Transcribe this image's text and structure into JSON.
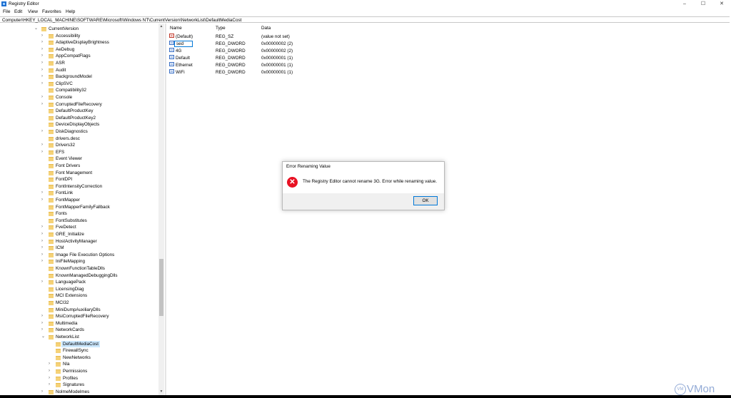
{
  "window": {
    "title": "Registry Editor",
    "controls": {
      "minimize": "–",
      "maximize": "☐",
      "close": "✕"
    }
  },
  "menu": [
    "File",
    "Edit",
    "View",
    "Favorites",
    "Help"
  ],
  "address": "Computer\\HKEY_LOCAL_MACHINE\\SOFTWARE\\Microsoft\\Windows NT\\CurrentVersion\\NetworkList\\DefaultMediaCost",
  "tree": {
    "items": [
      {
        "label": "CurrentVersion",
        "level": 0,
        "expanded": true
      },
      {
        "label": "Accessibility",
        "level": 1,
        "expandable": true
      },
      {
        "label": "AdaptiveDisplayBrightness",
        "level": 1,
        "expandable": true
      },
      {
        "label": "AeDebug",
        "level": 1,
        "expandable": true
      },
      {
        "label": "AppCompatFlags",
        "level": 1,
        "expandable": true
      },
      {
        "label": "ASR",
        "level": 1,
        "expandable": true
      },
      {
        "label": "Audit",
        "level": 1,
        "expandable": true
      },
      {
        "label": "BackgroundModel",
        "level": 1,
        "expandable": true
      },
      {
        "label": "ClipSVC",
        "level": 1,
        "expandable": true
      },
      {
        "label": "Compatibility32",
        "level": 1,
        "expandable": false
      },
      {
        "label": "Console",
        "level": 1,
        "expandable": true
      },
      {
        "label": "CorruptedFileRecovery",
        "level": 1,
        "expandable": true
      },
      {
        "label": "DefaultProductKey",
        "level": 1,
        "expandable": false
      },
      {
        "label": "DefaultProductKey2",
        "level": 1,
        "expandable": false
      },
      {
        "label": "DeviceDisplayObjects",
        "level": 1,
        "expandable": false
      },
      {
        "label": "DiskDiagnostics",
        "level": 1,
        "expandable": true
      },
      {
        "label": "drivers.desc",
        "level": 1,
        "expandable": false
      },
      {
        "label": "Drivers32",
        "level": 1,
        "expandable": true
      },
      {
        "label": "EFS",
        "level": 1,
        "expandable": true
      },
      {
        "label": "Event Viewer",
        "level": 1,
        "expandable": false
      },
      {
        "label": "Font Drivers",
        "level": 1,
        "expandable": false
      },
      {
        "label": "Font Management",
        "level": 1,
        "expandable": false
      },
      {
        "label": "FontDPI",
        "level": 1,
        "expandable": false
      },
      {
        "label": "FontIntensityCorrection",
        "level": 1,
        "expandable": false
      },
      {
        "label": "FontLink",
        "level": 1,
        "expandable": true
      },
      {
        "label": "FontMapper",
        "level": 1,
        "expandable": true
      },
      {
        "label": "FontMapperFamilyFallback",
        "level": 1,
        "expandable": false
      },
      {
        "label": "Fonts",
        "level": 1,
        "expandable": false
      },
      {
        "label": "FontSubstitutes",
        "level": 1,
        "expandable": false
      },
      {
        "label": "FveDetect",
        "level": 1,
        "expandable": true
      },
      {
        "label": "GRE_Initialize",
        "level": 1,
        "expandable": true
      },
      {
        "label": "HostActivityManager",
        "level": 1,
        "expandable": true
      },
      {
        "label": "ICM",
        "level": 1,
        "expandable": true
      },
      {
        "label": "Image File Execution Options",
        "level": 1,
        "expandable": true
      },
      {
        "label": "IniFileMapping",
        "level": 1,
        "expandable": true
      },
      {
        "label": "KnownFunctionTableDlls",
        "level": 1,
        "expandable": false
      },
      {
        "label": "KnownManagedDebuggingDlls",
        "level": 1,
        "expandable": false
      },
      {
        "label": "LanguagePack",
        "level": 1,
        "expandable": true
      },
      {
        "label": "LicensingDiag",
        "level": 1,
        "expandable": false
      },
      {
        "label": "MCI Extensions",
        "level": 1,
        "expandable": false
      },
      {
        "label": "MCI32",
        "level": 1,
        "expandable": false
      },
      {
        "label": "MiniDumpAuxiliaryDlls",
        "level": 1,
        "expandable": false
      },
      {
        "label": "MsiCorruptedFileRecovery",
        "level": 1,
        "expandable": true
      },
      {
        "label": "Multimedia",
        "level": 1,
        "expandable": true
      },
      {
        "label": "NetworkCards",
        "level": 1,
        "expandable": true
      },
      {
        "label": "NetworkList",
        "level": 1,
        "expanded": true
      },
      {
        "label": "DefaultMediaCost",
        "level": 2,
        "expandable": false,
        "selected": true
      },
      {
        "label": "FirewallSync",
        "level": 2,
        "expandable": false
      },
      {
        "label": "NewNetworks",
        "level": 2,
        "expandable": false
      },
      {
        "label": "Nla",
        "level": 2,
        "expandable": true
      },
      {
        "label": "Permissions",
        "level": 2,
        "expandable": true
      },
      {
        "label": "Profiles",
        "level": 2,
        "expandable": true
      },
      {
        "label": "Signatures",
        "level": 2,
        "expandable": true
      },
      {
        "label": "NolmeModelmes",
        "level": 1,
        "expandable": true
      }
    ]
  },
  "list": {
    "headers": {
      "name": "Name",
      "type": "Type",
      "data": "Data"
    },
    "rows": [
      {
        "name": "(Default)",
        "type": "REG_SZ",
        "data": "(value not set)",
        "icon": "sz"
      },
      {
        "name": "sed",
        "type": "REG_DWORD",
        "data": "0x00000002 (2)",
        "icon": "dword",
        "editing": true
      },
      {
        "name": "4G",
        "type": "REG_DWORD",
        "data": "0x00000002 (2)",
        "icon": "dword"
      },
      {
        "name": "Default",
        "type": "REG_DWORD",
        "data": "0x00000001 (1)",
        "icon": "dword"
      },
      {
        "name": "Ethernet",
        "type": "REG_DWORD",
        "data": "0x00000001 (1)",
        "icon": "dword"
      },
      {
        "name": "WiFi",
        "type": "REG_DWORD",
        "data": "0x00000001 (1)",
        "icon": "dword"
      }
    ]
  },
  "dialog": {
    "title": "Error Renaming Value",
    "message": "The Registry Editor cannot rename 3G. Error while renaming value.",
    "ok_label": "OK",
    "icon_glyph": "✕"
  },
  "watermark": {
    "badge": "VM",
    "text": "VMon"
  },
  "colors": {
    "selection": "#cce8ff",
    "folder": "#f5d278",
    "error": "#e81123",
    "accent": "#0078d7"
  }
}
